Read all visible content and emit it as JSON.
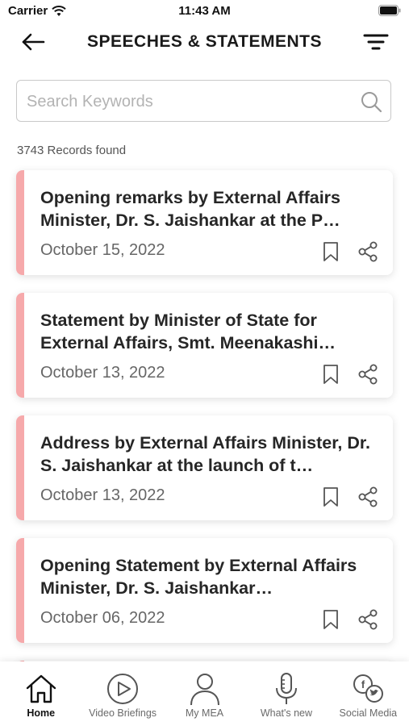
{
  "status_bar": {
    "carrier": "Carrier",
    "time": "11:43 AM"
  },
  "header": {
    "title": "SPEECHES & STATEMENTS"
  },
  "search": {
    "placeholder": "Search Keywords",
    "value": ""
  },
  "records_count": "3743 Records found",
  "colors": {
    "accent": "#f6a9ab",
    "text": "#262626"
  },
  "cards": [
    {
      "title": "Opening remarks by External Affairs Minister, Dr. S. Jaishankar at the P…",
      "date": "October 15, 2022"
    },
    {
      "title": "Statement by Minister of State for External Affairs, Smt.  Meenakashi…",
      "date": "October 13, 2022"
    },
    {
      "title": "Address by External Affairs Minister, Dr. S. Jaishankar at the launch of t…",
      "date": "October 13, 2022"
    },
    {
      "title": "Opening Statement by External Affairs Minister, Dr. S. Jaishankar…",
      "date": "October 06, 2022"
    }
  ],
  "card_icons": {
    "bookmark": "bookmark-icon",
    "share": "share-icon"
  },
  "bottom_nav": [
    {
      "label": "Home",
      "icon": "home-icon",
      "active": true
    },
    {
      "label": "Video Briefings",
      "icon": "play-icon",
      "active": false
    },
    {
      "label": "My MEA",
      "icon": "user-icon",
      "active": false
    },
    {
      "label": "What's new",
      "icon": "microphone-icon",
      "active": false
    },
    {
      "label": "Social Media",
      "icon": "social-media-icon",
      "active": false
    }
  ]
}
